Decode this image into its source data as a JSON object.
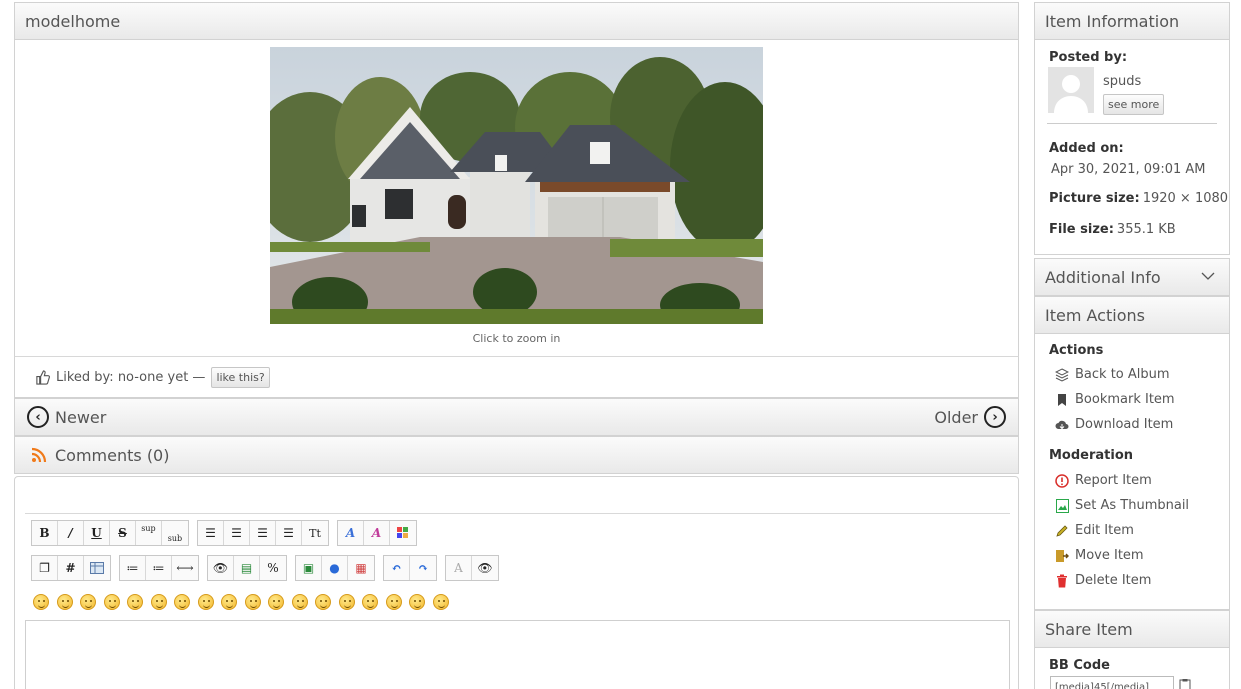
{
  "item": {
    "title": "modelhome",
    "zoom_caption": "Click to zoom in"
  },
  "likes": {
    "text": "Liked by: no-one yet —",
    "button_label": "like this?"
  },
  "nav": {
    "newer_label": "Newer",
    "older_label": "Older"
  },
  "comments": {
    "heading": "Comments (0)"
  },
  "editor": {
    "row1": [
      "B",
      "I",
      "U",
      "S",
      "sup",
      "sub",
      "align-left",
      "align-center",
      "align-right",
      "justify",
      "Tt",
      "font-color",
      "font-style",
      "color-grid"
    ],
    "row2": [
      "quote",
      "#",
      "table",
      "bullet-list",
      "number-list",
      "hr",
      "preview",
      "image-folder",
      "percent",
      "insert-image",
      "globe",
      "media",
      "undo",
      "redo",
      "clear-format",
      "eye"
    ],
    "emoji_count": 18
  },
  "sidebar": {
    "item_info": {
      "heading": "Item Information",
      "posted_by_label": "Posted by:",
      "username": "spuds",
      "see_more_label": "see more",
      "added_on_label": "Added on:",
      "added_on_value": "Apr 30, 2021, 09:01 AM",
      "picture_size_label": "Picture size:",
      "picture_size_value": "1920 × 1080",
      "file_size_label": "File size:",
      "file_size_value": "355.1 KB"
    },
    "additional_info": {
      "heading": "Additional Info"
    },
    "item_actions": {
      "heading": "Item Actions",
      "actions_label": "Actions",
      "back_to_album": "Back to Album",
      "bookmark": "Bookmark Item",
      "download": "Download Item",
      "moderation_label": "Moderation",
      "report": "Report Item",
      "set_thumbnail": "Set As Thumbnail",
      "edit": "Edit Item",
      "move": "Move Item",
      "delete": "Delete Item"
    },
    "share": {
      "heading": "Share Item",
      "bbcode_label": "BB Code",
      "bbcode_value": "[media]45[/media]"
    }
  },
  "colors": {
    "rss": "#f07a1a",
    "report": "#d9302c",
    "thumbnail": "#2aa84a",
    "edit": "#9a8a1a",
    "move": "#8a6a1a",
    "delete": "#e03030"
  }
}
